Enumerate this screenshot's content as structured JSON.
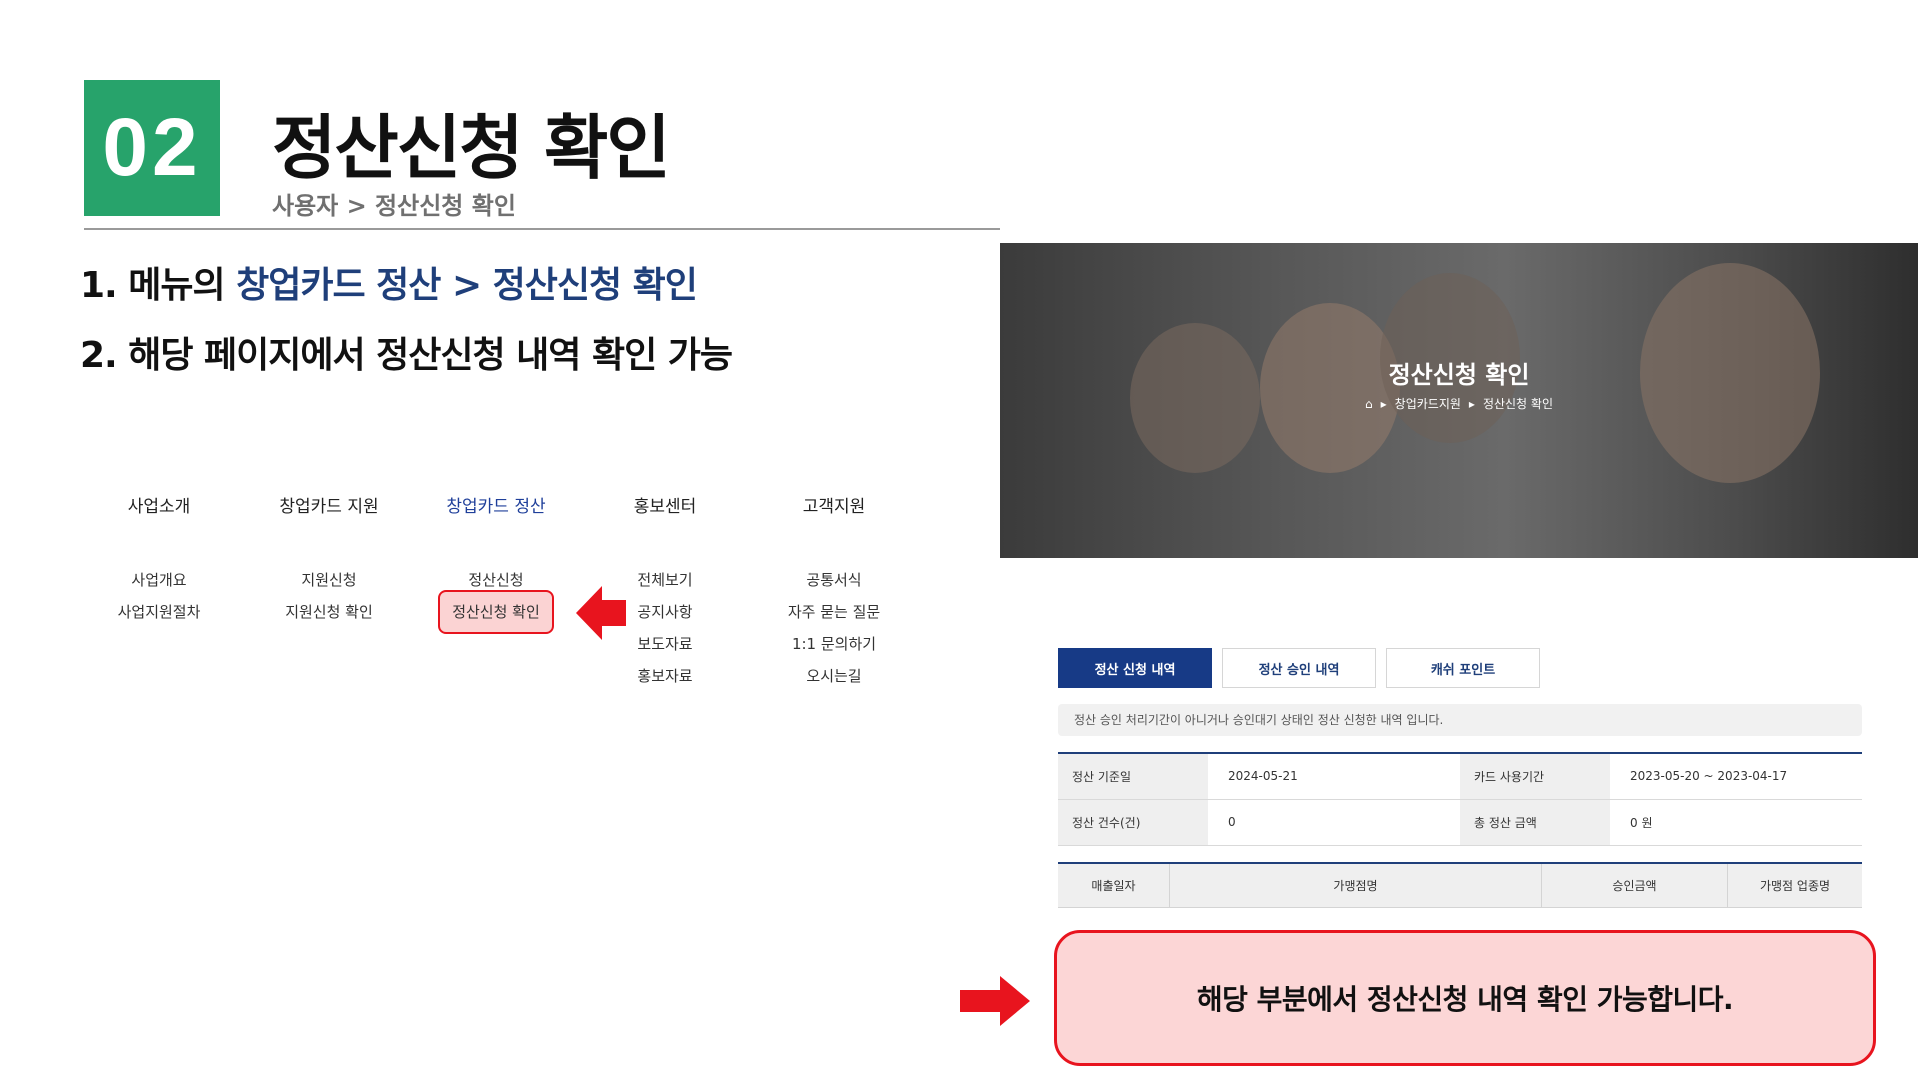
{
  "header": {
    "number": "02",
    "title": "정산신청 확인",
    "breadcrumb": "사용자 > 정산신청 확인"
  },
  "steps": {
    "step1_prefix": "1. 메뉴의 ",
    "step1_highlight": "창업카드 정산 > 정산신청 확인",
    "step2": "2. 해당 페이지에서 정산신청 내역 확인 가능"
  },
  "menu": [
    {
      "label": "사업소개",
      "items": [
        "사업개요",
        "사업지원절차"
      ]
    },
    {
      "label": "창업카드 지원",
      "items": [
        "지원신청",
        "지원신청 확인"
      ]
    },
    {
      "label": "창업카드 정산",
      "items": [
        "정산신청",
        "정산신청 확인"
      ]
    },
    {
      "label": "홍보센터",
      "items": [
        "전체보기",
        "공지사항",
        "보도자료",
        "홍보자료"
      ]
    },
    {
      "label": "고객지원",
      "items": [
        "공통서식",
        "자주 묻는 질문",
        "1:1 문의하기",
        "오시는길"
      ]
    }
  ],
  "banner": {
    "title": "정산신청 확인",
    "crumb_section": "창업카드지원",
    "crumb_page": "정산신청 확인"
  },
  "tabs": [
    "정산 신청 내역",
    "정산 승인 내역",
    "캐쉬 포인트"
  ],
  "notice": "정산 승인 처리기간이 아니거나 승인대기 상태인 정산 신청한 내역 입니다.",
  "info": {
    "base_date_label": "정산 기준일",
    "base_date_value": "2024-05-21",
    "card_period_label": "카드 사용기간",
    "card_period_value": "2023-05-20 ~ 2023-04-17",
    "count_label": "정산 건수(건)",
    "count_value": "0",
    "total_label": "총 정산 금액",
    "total_value": "0 원"
  },
  "list_columns": [
    "매출일자",
    "가맹점명",
    "승인금액",
    "가맹점 업종명"
  ],
  "callout": "해당 부분에서 정산신청 내역 확인 가능합니다.",
  "colors": {
    "green": "#27a36b",
    "navy": "#1f3f7a",
    "red": "#e8141e",
    "pink": "#fcd6d6"
  }
}
